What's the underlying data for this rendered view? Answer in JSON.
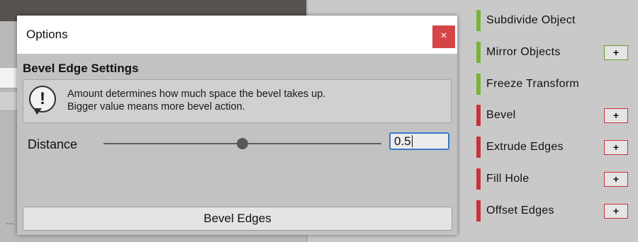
{
  "background": {
    "ellipsis": "..."
  },
  "dialog": {
    "title": "Options",
    "close_glyph": "×",
    "section_header": "Bevel Edge Settings",
    "help": {
      "icon": "warning-speech-icon",
      "line1": "Amount determines how much space the bevel takes up.",
      "line2": "Bigger value means more bevel action."
    },
    "distance": {
      "label": "Distance",
      "value": "0.5",
      "slider_fraction": 0.5
    },
    "action_button": "Bevel Edges"
  },
  "tools": [
    {
      "label": "Subdivide Object",
      "status": "green",
      "has_plus": false
    },
    {
      "label": "Mirror Objects",
      "status": "green",
      "has_plus": true
    },
    {
      "label": "Freeze Transform",
      "status": "green",
      "has_plus": false
    },
    {
      "label": "Bevel",
      "status": "red",
      "has_plus": true
    },
    {
      "label": "Extrude Edges",
      "status": "red",
      "has_plus": true
    },
    {
      "label": "Fill Hole",
      "status": "red",
      "has_plus": true
    },
    {
      "label": "Offset Edges",
      "status": "red",
      "has_plus": true
    }
  ],
  "plus_glyph": "+",
  "colors": {
    "green": "#7ab33a",
    "red": "#c8323c",
    "close_bg": "#d64545",
    "focus": "#3b78c8"
  }
}
